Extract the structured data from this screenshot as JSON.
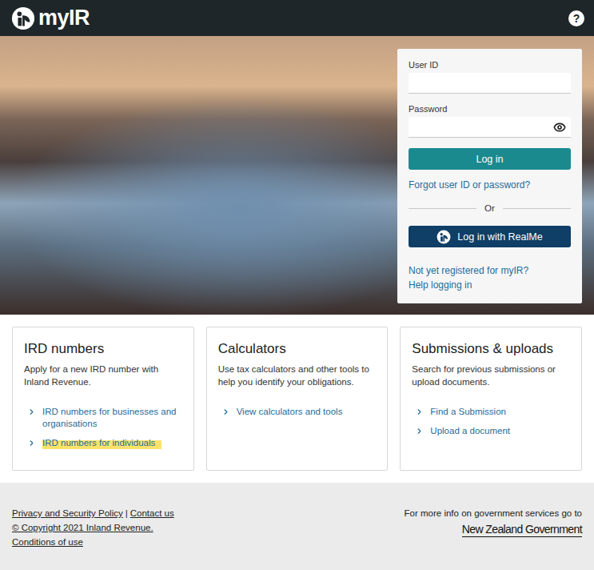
{
  "header": {
    "logo": "myIR",
    "help": "?"
  },
  "login": {
    "user_id_label": "User ID",
    "password_label": "Password",
    "login_button": "Log in",
    "forgot_link": "Forgot user ID or password?",
    "divider": "Or",
    "realme_button": "Log in with RealMe",
    "register_link": "Not yet registered for myIR?",
    "help_link": "Help logging in"
  },
  "cards": [
    {
      "title": "IRD numbers",
      "description": "Apply for a new IRD number with Inland Revenue.",
      "links": [
        {
          "label": "IRD numbers for businesses and organisations",
          "highlighted": false
        },
        {
          "label": "IRD numbers for individuals",
          "highlighted": true
        }
      ]
    },
    {
      "title": "Calculators",
      "description": "Use tax calculators and other tools to help you identify your obligations.",
      "links": [
        {
          "label": "View calculators and tools",
          "highlighted": false
        }
      ]
    },
    {
      "title": "Submissions & uploads",
      "description": "Search for previous submissions or upload documents.",
      "links": [
        {
          "label": "Find a Submission",
          "highlighted": false
        },
        {
          "label": "Upload a document",
          "highlighted": false
        }
      ]
    }
  ],
  "footer": {
    "links": [
      "Privacy and Security Policy",
      "Contact us"
    ],
    "separator": "|",
    "copyright": "© Copyright 2021 Inland Revenue.",
    "conditions": "Conditions of use",
    "gov_text": "For more info on government services go to",
    "gov_logo": "New Zealand Government"
  }
}
